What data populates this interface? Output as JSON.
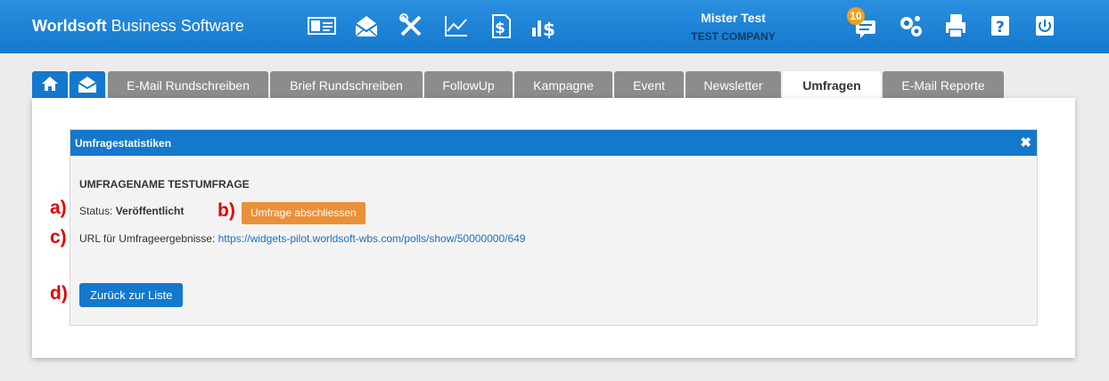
{
  "header": {
    "brand_bold": "Worldsoft",
    "brand_rest": " Business Software",
    "user_name": "Mister Test",
    "company": "TEST COMPANY",
    "notification_count": "10"
  },
  "toolbar_icons": [
    "contact-card-icon",
    "mail-campaign-icon",
    "tools-icon",
    "chart-icon",
    "invoice-icon",
    "revenue-icon"
  ],
  "header_icons": [
    "chat-icon",
    "settings-icon",
    "print-icon",
    "help-icon",
    "power-icon"
  ],
  "tabs": [
    {
      "label": "E-Mail Rundschreiben"
    },
    {
      "label": "Brief Rundschreiben"
    },
    {
      "label": "FollowUp"
    },
    {
      "label": "Kampagne"
    },
    {
      "label": "Event"
    },
    {
      "label": "Newsletter"
    },
    {
      "label": "Umfragen",
      "active": true
    },
    {
      "label": "E-Mail Reporte"
    }
  ],
  "dialog": {
    "title": "Umfragestatistiken",
    "survey_name": "UMFRAGENAME TESTUMFRAGE",
    "status_label": "Status: ",
    "status_value": "Veröffentlicht",
    "close_survey_button": "Umfrage abschliessen",
    "url_label": "URL für Umfrageergebnisse: ",
    "url": "https://widgets-pilot.worldsoft-wbs.com/polls/show/50000000/649",
    "back_button": "Zurück zur Liste"
  },
  "markers": [
    "a)",
    "b)",
    "c)",
    "d)"
  ],
  "colors": {
    "primary": "#1478cd",
    "orange": "#e9913a",
    "marker": "#e00000",
    "tab_inactive": "#8c8c8c"
  }
}
